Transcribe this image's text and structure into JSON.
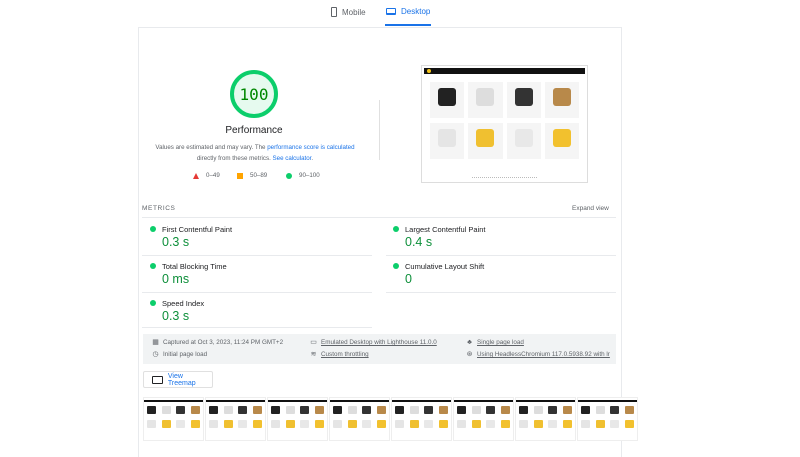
{
  "tabs": [
    {
      "label": "Mobile",
      "icon": "phone-icon",
      "active": false
    },
    {
      "label": "Desktop",
      "icon": "laptop-icon",
      "active": true
    }
  ],
  "score": {
    "value": "100",
    "label": "Performance",
    "color": "#0cce6b"
  },
  "description": {
    "prefix": "Values are estimated and may vary. The ",
    "link1": "performance score is calculated",
    "middle": " directly from these metrics. ",
    "link2": "See calculator",
    "suffix": "."
  },
  "legend": [
    {
      "range": "0–49",
      "shape": "triangle",
      "color": "#e53935"
    },
    {
      "range": "50–89",
      "shape": "square",
      "color": "#ffa400"
    },
    {
      "range": "90–100",
      "shape": "circle",
      "color": "#0cce6b"
    }
  ],
  "metrics": {
    "label": "METRICS",
    "expand": "Expand view",
    "items": [
      {
        "name": "First Contentful Paint",
        "value": "0.3 s"
      },
      {
        "name": "Largest Contentful Paint",
        "value": "0.4 s"
      },
      {
        "name": "Total Blocking Time",
        "value": "0 ms"
      },
      {
        "name": "Cumulative Layout Shift",
        "value": "0"
      },
      {
        "name": "Speed Index",
        "value": "0.3 s"
      }
    ]
  },
  "info": {
    "captured": "Captured at Oct 3, 2023, 11:24 PM GMT+2",
    "initial": "Initial page load",
    "emulated": "Emulated Desktop with Lighthouse 11.0.0",
    "throttling": "Custom throttling",
    "single": "Single page load",
    "browser": "Using HeadlessChromium 117.0.5938.92 with lr"
  },
  "treemap": "View Treemap"
}
